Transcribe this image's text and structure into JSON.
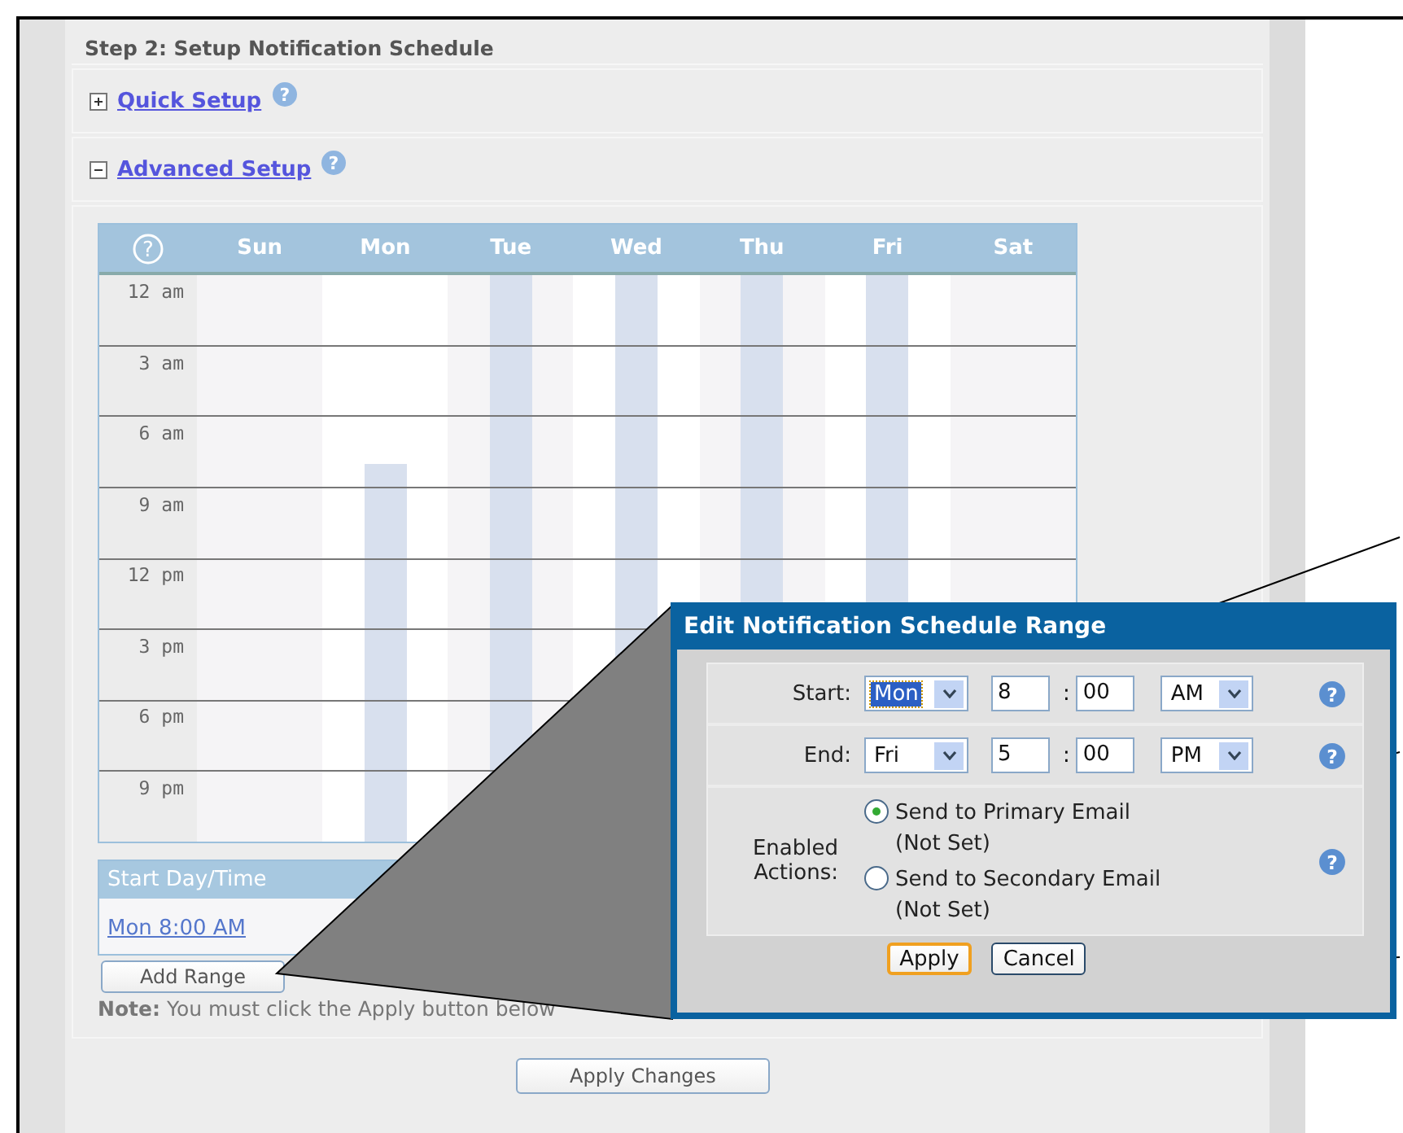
{
  "section_title": "Step 2: Setup Notification Schedule",
  "setup_options": [
    {
      "label": "Quick Setup",
      "expanded": false
    },
    {
      "label": "Advanced Setup",
      "expanded": true
    }
  ],
  "schedule": {
    "days": [
      {
        "label": "Sun",
        "kind": "none"
      },
      {
        "label": "Mon",
        "kind": "partial"
      },
      {
        "label": "Tue",
        "kind": "full"
      },
      {
        "label": "Wed",
        "kind": "full"
      },
      {
        "label": "Thu",
        "kind": "full"
      },
      {
        "label": "Fri",
        "kind": "full"
      },
      {
        "label": "Sat",
        "kind": "none"
      }
    ],
    "times": [
      "12 am",
      "3 am",
      "6 am",
      "9 am",
      "12 pm",
      "3 pm",
      "6 pm",
      "9 pm"
    ]
  },
  "ranges_table": {
    "column": "Start Day/Time",
    "rows": [
      "Mon 8:00 AM"
    ]
  },
  "help_mark": "?",
  "range_buttons": [
    "Add Range"
  ],
  "note": "**Note:** You must click the Apply button below",
  "apply_changes": "Apply Changes",
  "dialog": {
    "title": "Edit Notification Schedule Range",
    "separator": ":",
    "rows": [
      {
        "label": "Start:",
        "day": "Mon",
        "hour": "8",
        "minute": "00",
        "period": "AM",
        "focused": true
      },
      {
        "label": "End:",
        "day": "Fri",
        "hour": "5",
        "minute": "00",
        "period": "PM",
        "focused": false
      }
    ],
    "actions_label": "Enabled Actions:",
    "actions": [
      {
        "label": "Send to Primary Email",
        "detail": "(Not Set)",
        "selected": true
      },
      {
        "label": "Send to Secondary Email",
        "detail": "(Not Set)",
        "selected": false
      }
    ],
    "buttons": [
      {
        "label": "Apply",
        "focused": true
      },
      {
        "label": "Cancel",
        "focused": false
      }
    ]
  }
}
